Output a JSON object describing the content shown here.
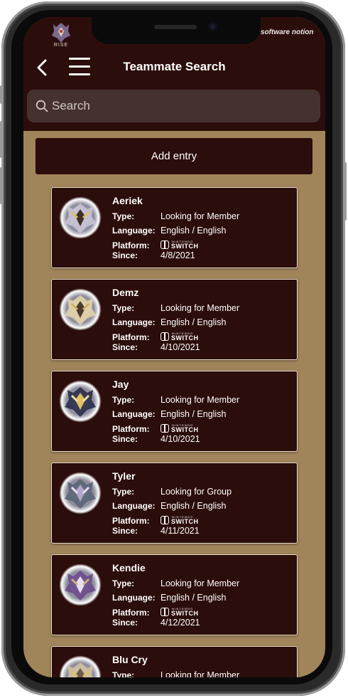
{
  "header": {
    "logo_text": "RISE",
    "brand": "software notion",
    "title": "Teammate Search"
  },
  "search": {
    "placeholder": "Search"
  },
  "add_entry_label": "Add entry",
  "labels": {
    "type": "Type:",
    "language": "Language:",
    "platform": "Platform:",
    "since": "Since:"
  },
  "platform_logo": {
    "top": "NINTENDO",
    "bottom": "SWITCH"
  },
  "entries": [
    {
      "name": "Aeriek",
      "type": "Looking for Member",
      "language": "English / English",
      "since": "4/8/2021"
    },
    {
      "name": "Demz",
      "type": "Looking for Member",
      "language": "English / English",
      "since": "4/10/2021"
    },
    {
      "name": "Jay",
      "type": "Looking for Member",
      "language": "English / English",
      "since": "4/10/2021"
    },
    {
      "name": "Tyler",
      "type": "Looking for Group",
      "language": "English / English",
      "since": "4/11/2021"
    },
    {
      "name": "Kendie",
      "type": "Looking for Member",
      "language": "English / English",
      "since": "4/12/2021"
    },
    {
      "name": "Blu Cry",
      "type": "Looking for Member",
      "language": "",
      "since": ""
    }
  ],
  "colors": {
    "header_bg": "#2b0d0b",
    "page_bg": "#a0845a",
    "card_border": "#e8dcc8",
    "search_bg": "#453230"
  }
}
